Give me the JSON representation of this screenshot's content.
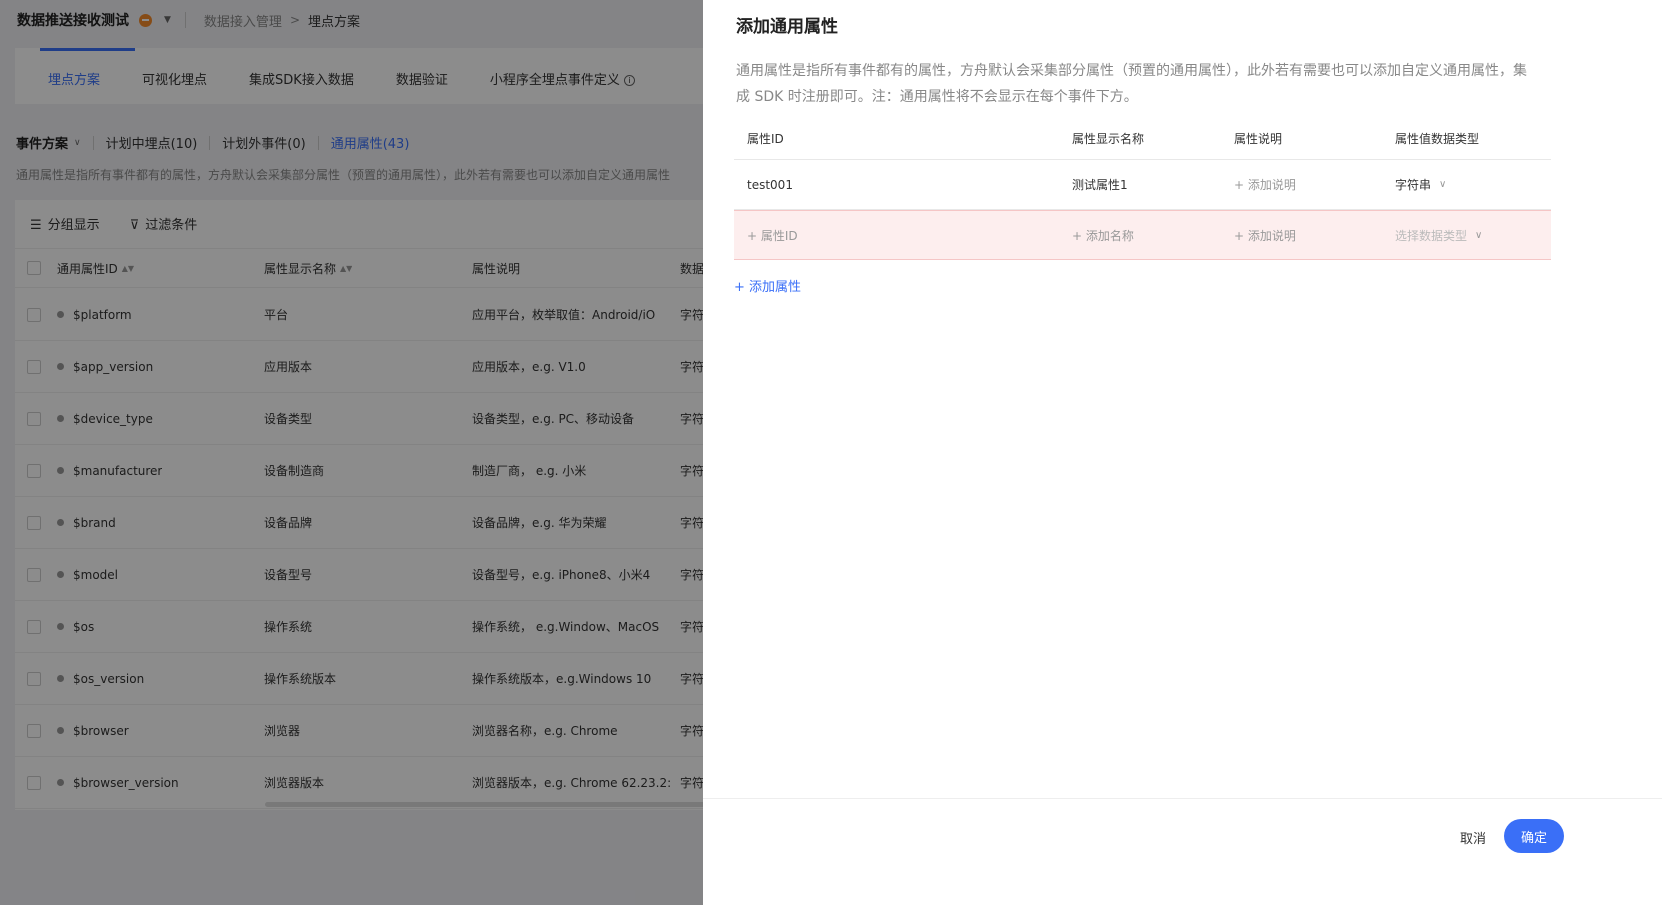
{
  "topbar": {
    "project_name": "数据推送接收测试",
    "breadcrumb": [
      "数据接入管理",
      "埋点方案"
    ]
  },
  "tabs": [
    "埋点方案",
    "可视化埋点",
    "集成SDK接入数据",
    "数据验证",
    "小程序全埋点事件定义"
  ],
  "subtabs": {
    "selector": "事件方案",
    "items": [
      "计划中埋点(10)",
      "计划外事件(0)",
      "通用属性(43)"
    ]
  },
  "background_desc": "通用属性是指所有事件都有的属性，方舟默认会采集部分属性（预置的通用属性），此外若有需要也可以添加自定义通用属性",
  "bg_toolbar": {
    "group": "分组显示",
    "filter": "过滤条件"
  },
  "bg_table": {
    "headers": [
      "通用属性ID",
      "属性显示名称",
      "属性说明",
      "数据"
    ],
    "rows": [
      {
        "id": "$platform",
        "name": "平台",
        "desc": "应用平台，枚举取值：Android/iO",
        "type": "字符"
      },
      {
        "id": "$app_version",
        "name": "应用版本",
        "desc": "应用版本，e.g. V1.0",
        "type": "字符"
      },
      {
        "id": "$device_type",
        "name": "设备类型",
        "desc": "设备类型，e.g. PC、移动设备",
        "type": "字符"
      },
      {
        "id": "$manufacturer",
        "name": "设备制造商",
        "desc": "制造厂商，  e.g. 小米",
        "type": "字符"
      },
      {
        "id": "$brand",
        "name": "设备品牌",
        "desc": "设备品牌，e.g. 华为荣耀",
        "type": "字符"
      },
      {
        "id": "$model",
        "name": "设备型号",
        "desc": "设备型号，e.g. iPhone8、小米4",
        "type": "字符"
      },
      {
        "id": "$os",
        "name": "操作系统",
        "desc": "操作系统，  e.g.Window、MacOS",
        "type": "字符"
      },
      {
        "id": "$os_version",
        "name": "操作系统版本",
        "desc": "操作系统版本，e.g.Windows 10",
        "type": "字符"
      },
      {
        "id": "$browser",
        "name": "浏览器",
        "desc": "浏览器名称，e.g. Chrome",
        "type": "字符"
      },
      {
        "id": "$browser_version",
        "name": "浏览器版本",
        "desc": "浏览器版本，e.g. Chrome 62.23.2:",
        "type": "字符"
      }
    ]
  },
  "drawer": {
    "title": "添加通用属性",
    "description": "通用属性是指所有事件都有的属性，方舟默认会采集部分属性（预置的通用属性），此外若有需要也可以添加自定义通用属性，集成 SDK 时注册即可。注：通用属性将不会显示在每个事件下方。",
    "headers": [
      "属性ID",
      "属性显示名称",
      "属性说明",
      "属性值数据类型"
    ],
    "row1": {
      "id": "test001",
      "name": "测试属性1",
      "desc": "+ 添加说明",
      "type": "字符串"
    },
    "row2": {
      "id": "+ 属性ID",
      "name": "+ 添加名称",
      "desc": "+ 添加说明",
      "type": "选择数据类型"
    },
    "add_attr": "+ 添加属性",
    "cancel": "取消",
    "confirm": "确定"
  },
  "colors": {
    "accent": "#3a6ff7",
    "status": "#f58a2a",
    "new_row_bg": "#fdeeee"
  }
}
